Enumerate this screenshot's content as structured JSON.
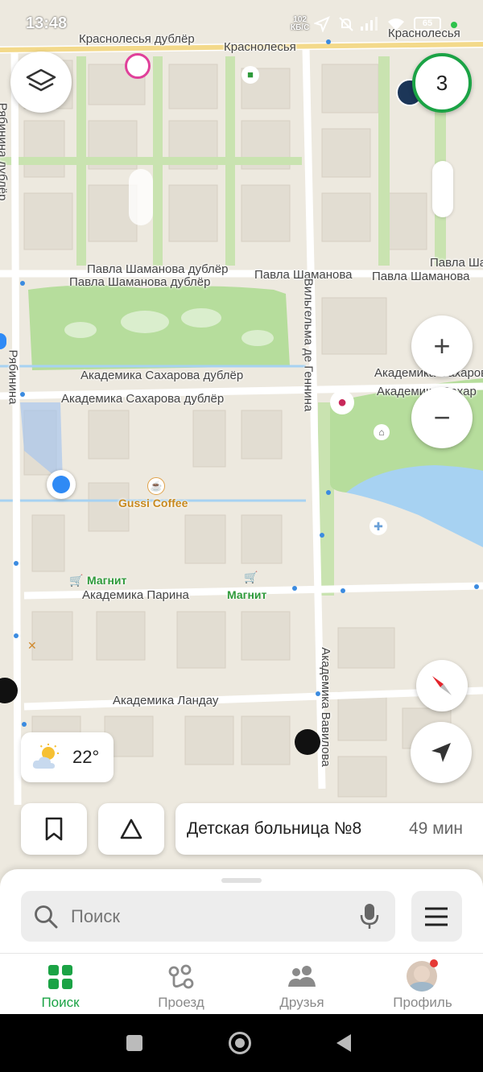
{
  "status_bar": {
    "time": "13:48",
    "net_speed_value": "102",
    "net_speed_unit": "КБ/С",
    "battery": "65"
  },
  "map": {
    "streets": [
      "Краснолесья дублёр",
      "Краснолесья",
      "Краснолесья",
      "Рябинина дублёр",
      "Рябинина",
      "Павла Шаманова дублёр",
      "Павла Шаманова дублёр",
      "Павла Шаманова",
      "Павла Шаманова",
      "Павла Шаманова",
      "Академика Сахарова дублёр",
      "Академика Сахарова дублёр",
      "Академика Сахарова",
      "Академика Сахар",
      "Вильгельма де Геннина",
      "Академика Парина",
      "Академика Ландау",
      "Академика Вавилова"
    ],
    "pois": [
      {
        "name": "Gussi Coffee",
        "color": "#c8891e"
      },
      {
        "name": "Магнит",
        "color": "#2e9a3a"
      },
      {
        "name": "Магнит",
        "color": "#2e9a3a"
      }
    ]
  },
  "controls": {
    "badge_count": "3",
    "zoom_in": "+",
    "zoom_out": "−"
  },
  "weather": {
    "temperature": "22°",
    "icon": "partly-cloudy-icon"
  },
  "route_card": {
    "destination": "Детская больница №8",
    "eta": "49 мин"
  },
  "search": {
    "placeholder": "Поиск"
  },
  "tabs": [
    {
      "label": "Поиск",
      "icon": "grid-icon",
      "active": true
    },
    {
      "label": "Проезд",
      "icon": "transit-icon",
      "active": false
    },
    {
      "label": "Друзья",
      "icon": "friends-icon",
      "active": false
    },
    {
      "label": "Профиль",
      "icon": "avatar-icon",
      "active": false
    }
  ],
  "colors": {
    "accent": "#1ba345",
    "water": "#a7d2f2",
    "park": "#b6dd9c",
    "road": "#ffffff",
    "location": "#2f8af5"
  }
}
